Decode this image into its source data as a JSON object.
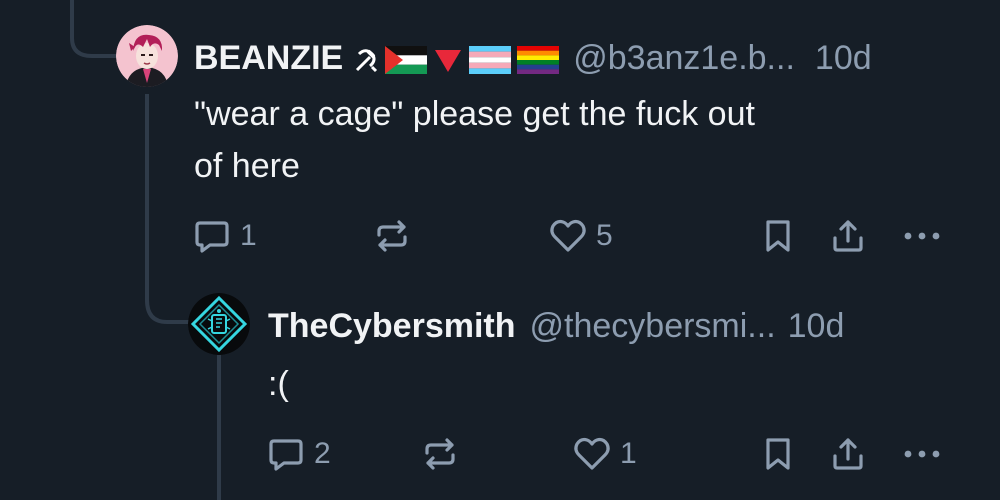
{
  "posts": [
    {
      "display_name": "BEANZIE",
      "badges": [
        "hammer-and-sickle",
        "palestine-flag",
        "red-triangle",
        "transgender-flag",
        "rainbow-flag"
      ],
      "handle": "@b3anz1e.b...",
      "timestamp": "10d",
      "text_lines": [
        "\"wear a cage\" please get the fuck out",
        "of here"
      ],
      "reply_count": "1",
      "repost_count": "",
      "like_count": "5"
    },
    {
      "display_name": "TheCybersmith",
      "handle": "@thecybersmi...",
      "timestamp": "10d",
      "text": ":(",
      "reply_count": "2",
      "repost_count": "",
      "like_count": "1"
    }
  ],
  "colors": {
    "background": "#161e27",
    "text_primary": "#f1f3f5",
    "text_secondary": "#8d9db0",
    "thread_line": "#2f3b49",
    "cyber_accent": "#35d6e0"
  }
}
